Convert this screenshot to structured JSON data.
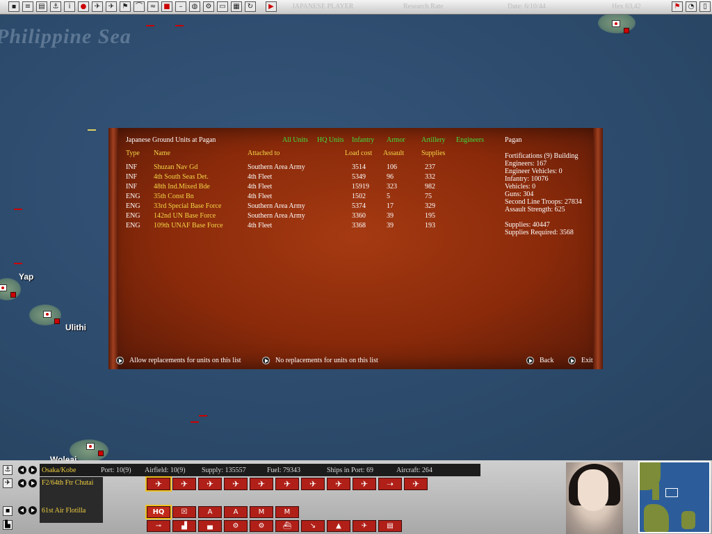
{
  "top_bar": {
    "title_center": "JAPANESE PLAYER",
    "status_center": "Research Rate",
    "date": "Date: 6/10/44",
    "right_text": "Hex 63,42"
  },
  "map": {
    "sea_label": "Philippine Sea",
    "places": [
      "Yap",
      "Ulithi",
      "Woleai"
    ]
  },
  "dialog": {
    "title": "Japanese Ground Units at Pagan",
    "filters": [
      "All Units",
      "HQ Units",
      "Infantry",
      "Armor",
      "Artillery",
      "Engineers"
    ],
    "columns": {
      "type": "Type",
      "name": "Name",
      "attached": "Attached to",
      "load": "Load cost",
      "assault": "Assault",
      "supplies": "Supplies"
    },
    "rows": [
      {
        "type": "INF",
        "name": "Shuzan Nav Gd",
        "attached": "Southern Area Army",
        "load": "3514",
        "assault": "106",
        "supplies": "237"
      },
      {
        "type": "INF",
        "name": "4th South Seas Det.",
        "attached": "4th Fleet",
        "load": "5349",
        "assault": "96",
        "supplies": "332"
      },
      {
        "type": "INF",
        "name": "48th Ind.Mixed Bde",
        "attached": "4th Fleet",
        "load": "15919",
        "assault": "323",
        "supplies": "982"
      },
      {
        "type": "ENG",
        "name": "35th Const Bn",
        "attached": "4th Fleet",
        "load": "1502",
        "assault": "5",
        "supplies": "75"
      },
      {
        "type": "ENG",
        "name": "33rd Special Base Force",
        "attached": "Southern Area Army",
        "load": "5374",
        "assault": "17",
        "supplies": "329"
      },
      {
        "type": "ENG",
        "name": "142nd UN Base Force",
        "attached": "Southern Area Army",
        "load": "3360",
        "assault": "39",
        "supplies": "195"
      },
      {
        "type": "ENG",
        "name": "109th UNAF Base Force",
        "attached": "4th Fleet",
        "load": "3368",
        "assault": "39",
        "supplies": "193"
      }
    ],
    "location": {
      "name": "Pagan",
      "fortifications": "Fortifications (9) Building",
      "engineers": "Engineers: 167",
      "engineer_vehicles": "Engineer Vehicles: 0",
      "infantry": "Infantry: 10076",
      "vehicles": "Vehicles: 0",
      "guns": "Guns: 304",
      "second_line": "Second Line Troops: 27834",
      "assault_strength": "Assault Strength: 625",
      "supplies": "Supplies: 40447",
      "supplies_required": "Supplies Required: 3568"
    },
    "buttons": {
      "allow": "Allow replacements for units on this list",
      "no": "No replacements for units on this list",
      "back": "Back",
      "exit": "Exit"
    }
  },
  "bottom_panel": {
    "base_name": "Osaka/Kobe",
    "port": "Port: 10(9)",
    "airfield": "Airfield: 10(9)",
    "supply": "Supply: 135557",
    "fuel": "Fuel: 79343",
    "ships": "Ships in Port: 69",
    "aircraft": "Aircraft: 264",
    "air_unit": "F2/64th Ftr Chutai",
    "hq_unit": "61st Air Flotilla",
    "hq_button": "HQ"
  },
  "colors": {
    "dialog_bg": "#8a2a0a",
    "filter_green": "#3fe03f",
    "name_yellow": "#f5d848",
    "ocean": "#2e4b6b"
  }
}
